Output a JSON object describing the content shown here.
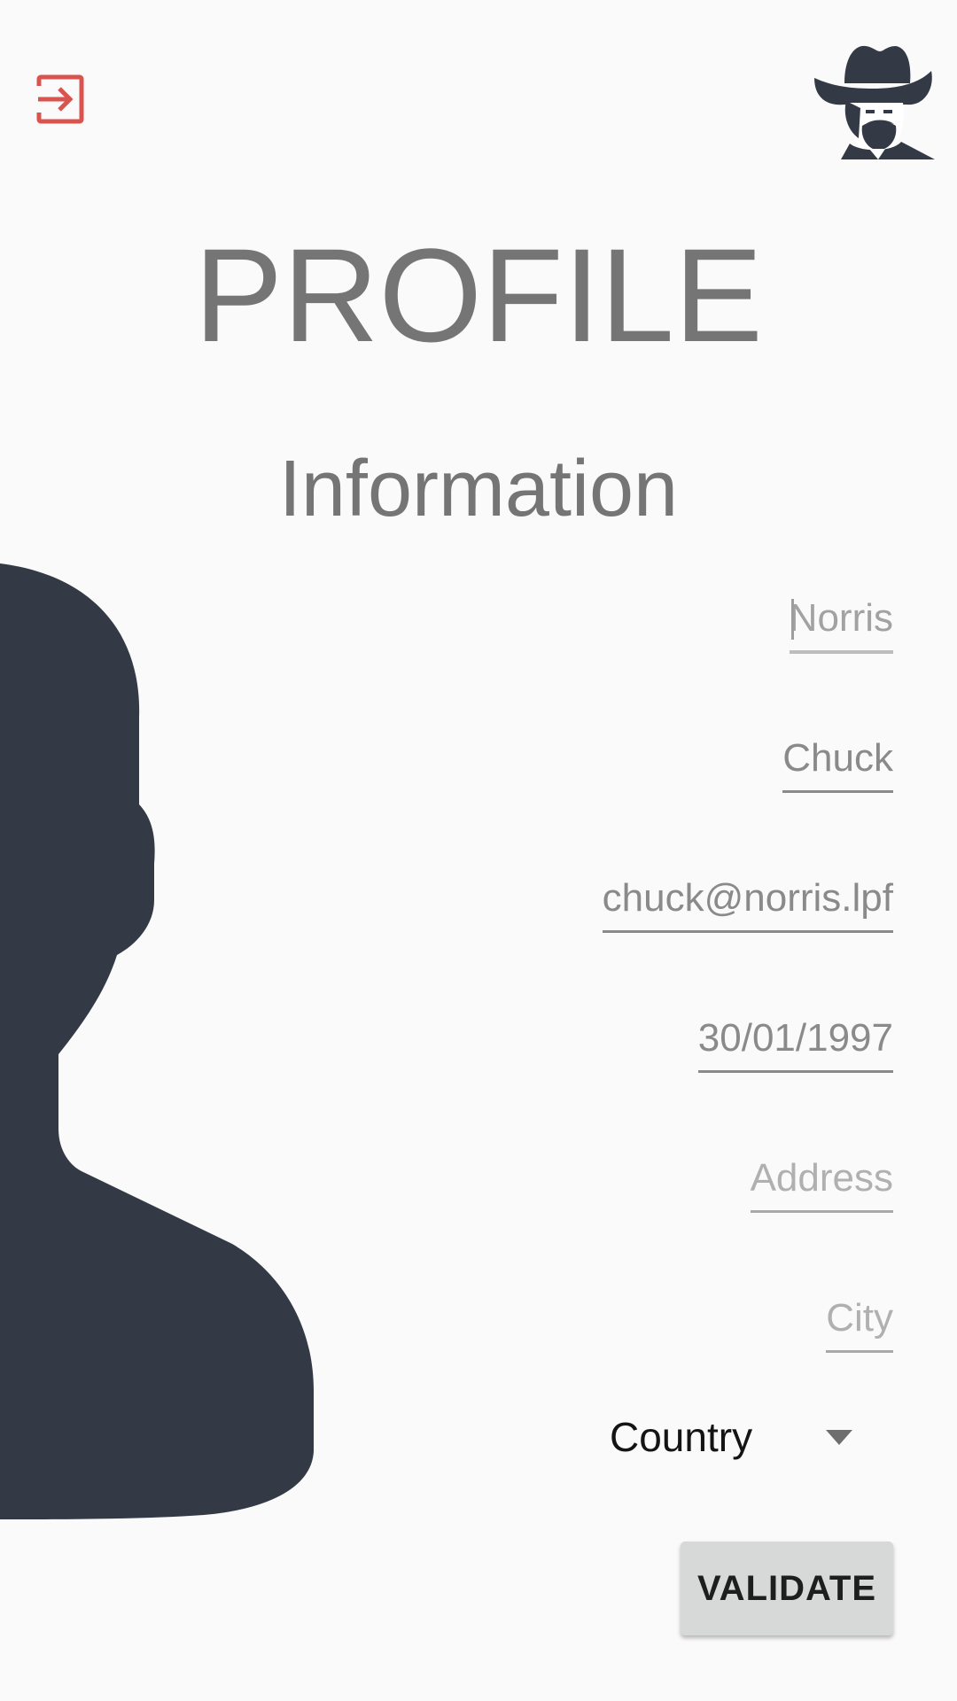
{
  "header": {
    "logout_icon": "logout-icon",
    "avatar_icon": "cowboy-avatar-icon"
  },
  "page": {
    "title": "PROFILE",
    "section_title": "Information"
  },
  "form": {
    "last_name": {
      "value": "Norris"
    },
    "first_name": {
      "value": "Chuck"
    },
    "email": {
      "value": "chuck@norris.lpf"
    },
    "birthdate": {
      "value": "30/01/1997"
    },
    "address": {
      "placeholder": "Address"
    },
    "city": {
      "placeholder": "City"
    },
    "country": {
      "selected": "Country"
    }
  },
  "actions": {
    "validate_label": "VALIDATE"
  },
  "colors": {
    "background": "#fafafa",
    "accent_red": "#d9534f",
    "silhouette": "#333a45",
    "title_gray": "#757575",
    "button_bg": "#d7d8d8"
  },
  "decor": {
    "silhouette_icon": "person-silhouette-icon"
  }
}
